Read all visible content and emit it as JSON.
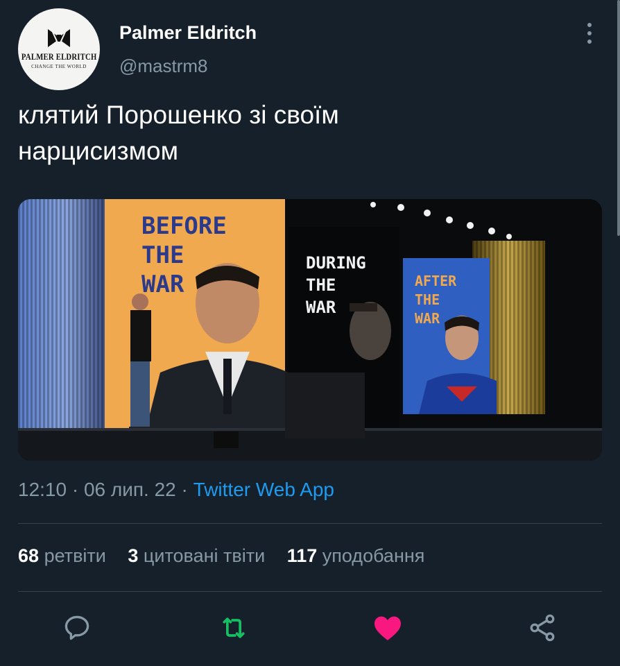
{
  "author": {
    "display_name": "Palmer Eldritch",
    "handle": "@mastrm8",
    "avatar_brand": "PALMER ELDRITCH",
    "avatar_tagline": "CHANGE THE WORLD"
  },
  "tweet": {
    "text_line1": "клятий Порошенко зі своїм",
    "text_line2": "нарцисизмом"
  },
  "image": {
    "before_text": [
      "BEFORE",
      "THE",
      "WAR"
    ],
    "during_text": [
      "DURING",
      "THE",
      "WAR"
    ],
    "after_text": [
      "AFTER",
      "THE",
      "WAR"
    ]
  },
  "meta": {
    "time": "12:10",
    "sep1": " · ",
    "date": "06 лип. 22",
    "sep2": " · ",
    "source": "Twitter Web App"
  },
  "stats": {
    "retweets_count": "68",
    "retweets_label": "ретвіти",
    "quotes_count": "3",
    "quotes_label": "цитовані твіти",
    "likes_count": "117",
    "likes_label": "уподобання"
  },
  "colors": {
    "background": "#15202b",
    "link": "#1d9bf0",
    "muted": "#8899a6",
    "retweet": "#17bf63",
    "like": "#f91880"
  },
  "icons": [
    "more-vertical-icon",
    "reply-icon",
    "retweet-icon",
    "like-icon",
    "share-icon"
  ]
}
